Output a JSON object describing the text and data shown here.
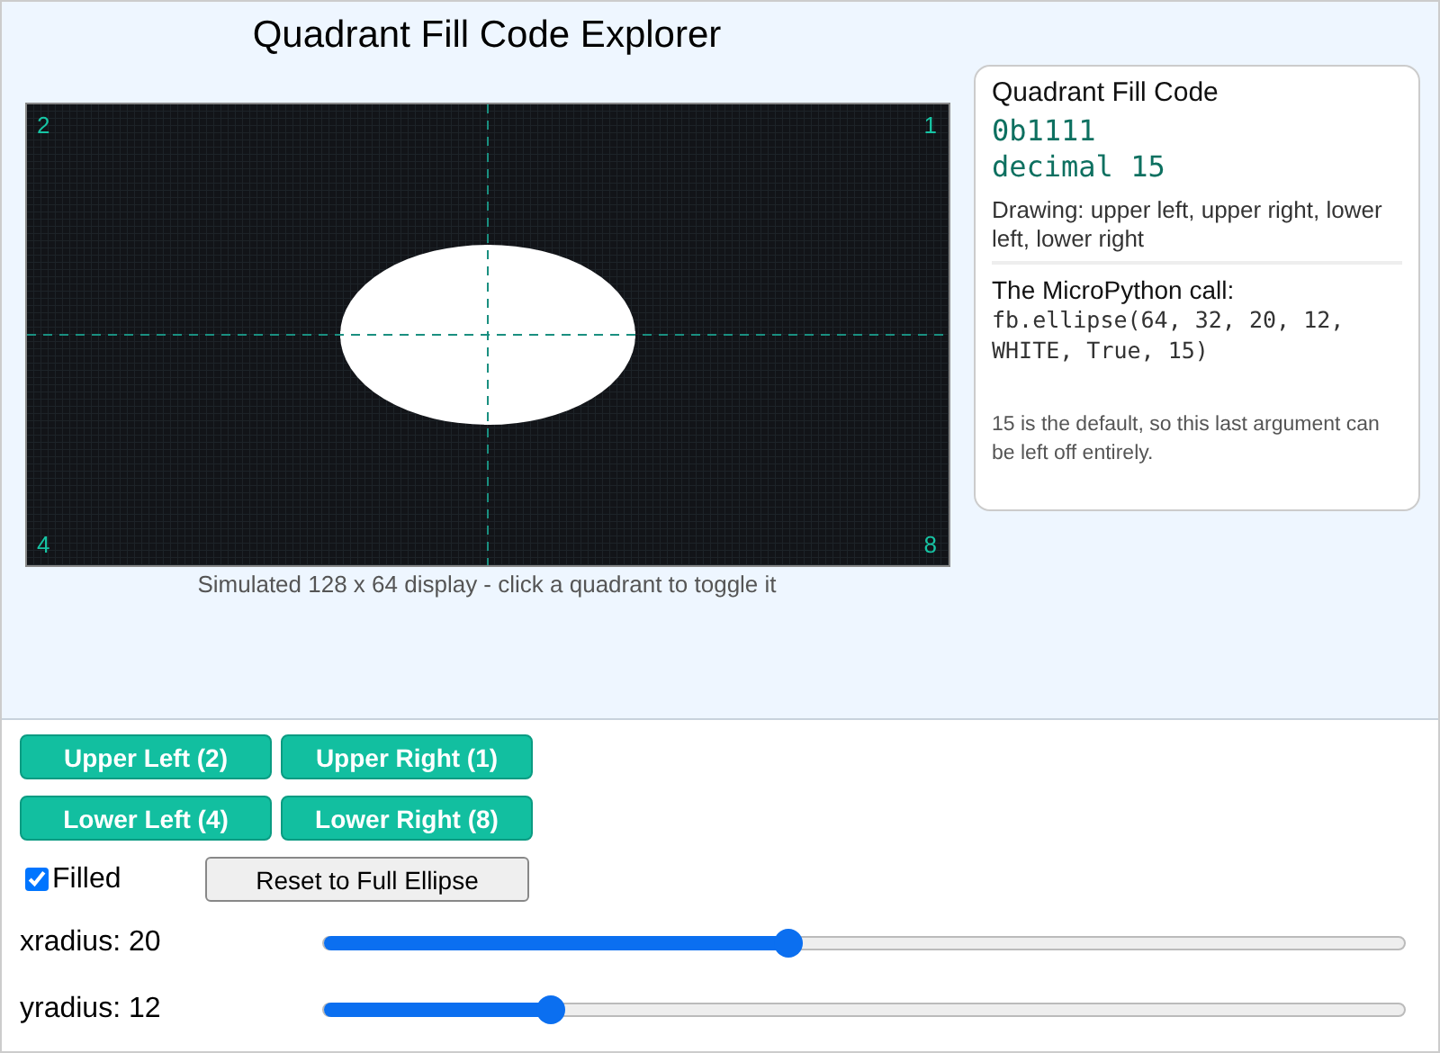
{
  "title": "Quadrant Fill Code Explorer",
  "quadrants": [
    {
      "kind": "upper-left",
      "corner": "2",
      "button": "Upper Left (2)",
      "on": true
    },
    {
      "kind": "upper-right",
      "corner": "1",
      "button": "Upper Right (1)",
      "on": true
    },
    {
      "kind": "lower-left",
      "corner": "4",
      "button": "Lower Left (4)",
      "on": true
    },
    {
      "kind": "lower-right",
      "corner": "8",
      "button": "Lower Right (8)",
      "on": true
    }
  ],
  "display_caption": "Simulated 128 x 64 display - click a quadrant to toggle it",
  "info": {
    "heading": "Quadrant Fill Code",
    "binary": "0b1111",
    "decimal": "decimal 15",
    "drawing": "Drawing: upper left, upper right, lower left, lower right",
    "call_label": "The MicroPython call:",
    "call_code": "fb.ellipse(64, 32, 20, 12, WHITE, True, 15)",
    "note": "15 is the default, so this last argument can be left off entirely."
  },
  "filled": {
    "label": "Filled",
    "checked": true
  },
  "reset_button": "Reset to Full Ellipse",
  "sliders": [
    {
      "label": "xradius: 20",
      "level": 0.43
    },
    {
      "label": "yradius: 12",
      "level": 0.21
    }
  ]
}
